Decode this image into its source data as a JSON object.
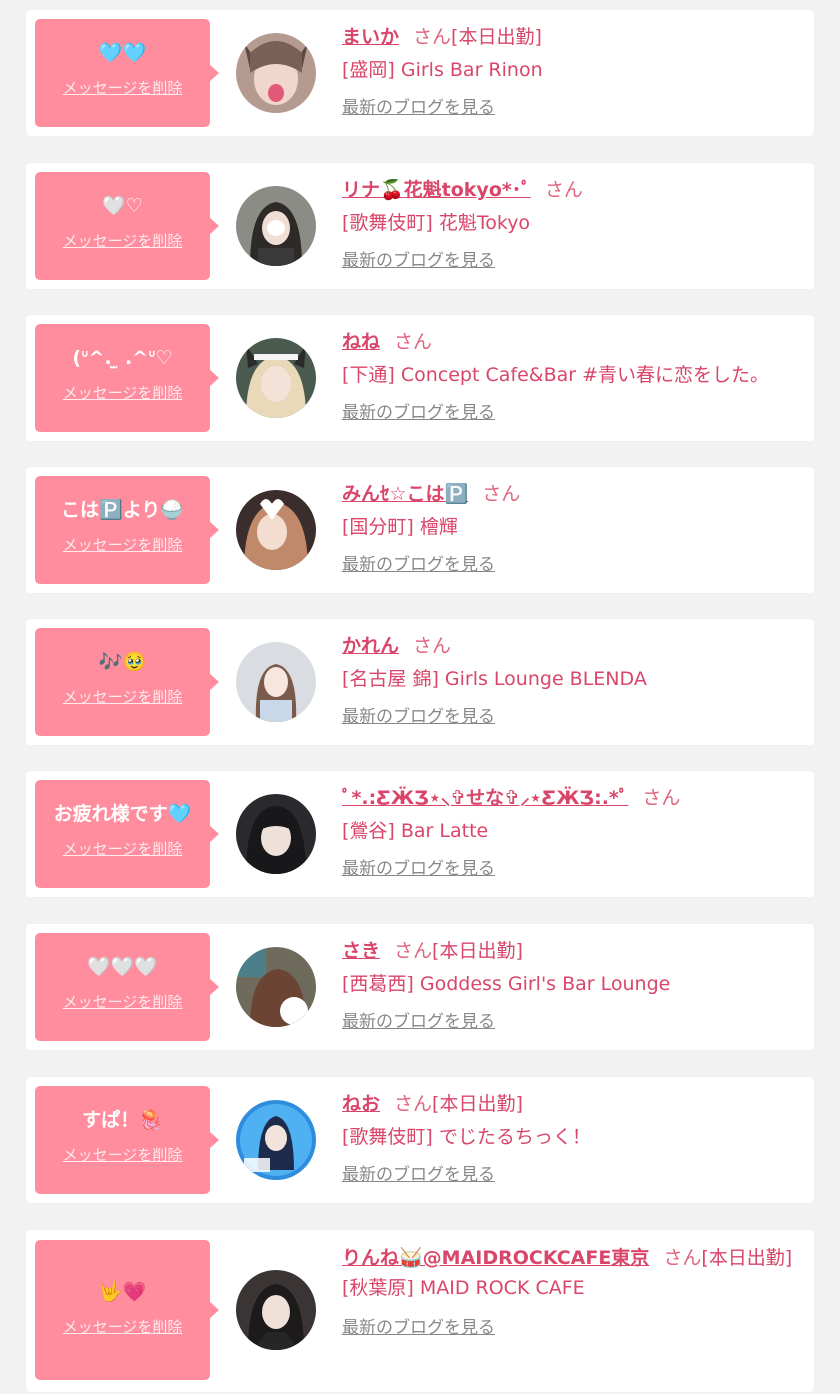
{
  "delete_label": "メッセージを削除",
  "blog_label": "最新のブログを見る",
  "san_label": "さん",
  "colors": {
    "bubble": "#ff8d9e",
    "text": "#d9466a",
    "background": "#f2f2f2"
  },
  "items": [
    {
      "message": "🩵🩵",
      "name": "まいか",
      "status": "[本日出勤]",
      "shop": "[盛岡] Girls Bar Rinon"
    },
    {
      "message": "🤍♡",
      "name": "リナ🍒花魁tokyo*･ﾟ",
      "status": "",
      "shop": "[歌舞伎町] 花魁Tokyo"
    },
    {
      "message": "(ᐡ^. ̫ .^ᐡ♡",
      "name": "ねね",
      "status": "",
      "shop": "[下通] Concept Cafe&Bar #青い春に恋をした。"
    },
    {
      "message": "こは🅿️より🍚",
      "name": "みんｾ☆こは🅿️",
      "status": "",
      "shop": "[国分町] 檜輝"
    },
    {
      "message": "🎶🥹",
      "name": "かれん",
      "status": "",
      "shop": "[名古屋 錦] Girls Lounge BLENDA"
    },
    {
      "message": "お疲れ様です🩵",
      "name": "ﾟ*.:ƸӜƷ⋆⸜✞せな✞⸝⋆ƸӜƷ:.*ﾟ",
      "status": "",
      "shop": "[鶯谷] Bar Latte"
    },
    {
      "message": "🤍🤍🤍",
      "name": "さき",
      "status": "[本日出勤]",
      "shop": "[西葛西] Goddess Girl's Bar Lounge"
    },
    {
      "message": "すぱ！🪼",
      "name": "ねお",
      "status": "[本日出勤]",
      "shop": "[歌舞伎町] でじたるちっく！"
    },
    {
      "message": "🤟💗",
      "name": "りんね🥁@MAIDROCKCAFE東京",
      "status": "[本日出勤]",
      "shop": "[秋葉原] MAID ROCK CAFE"
    }
  ]
}
